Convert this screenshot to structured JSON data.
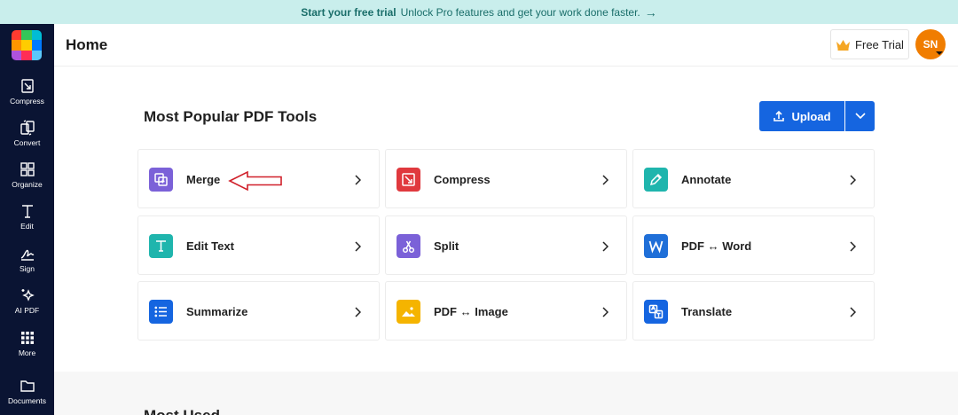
{
  "banner": {
    "bold_text": "Start your free trial",
    "text": "Unlock Pro features and get your work done faster.",
    "arrow": "→"
  },
  "sidebar": {
    "items": [
      {
        "label": "Compress",
        "icon": "compress-icon"
      },
      {
        "label": "Convert",
        "icon": "convert-icon"
      },
      {
        "label": "Organize",
        "icon": "organize-icon"
      },
      {
        "label": "Edit",
        "icon": "edit-text-icon"
      },
      {
        "label": "Sign",
        "icon": "sign-icon"
      },
      {
        "label": "AI PDF",
        "icon": "ai-sparkle-icon"
      },
      {
        "label": "More",
        "icon": "grid-dots-icon"
      },
      {
        "label": "Documents",
        "icon": "folder-icon"
      }
    ]
  },
  "header": {
    "title": "Home",
    "free_trial_label": "Free Trial",
    "avatar_initials": "SN"
  },
  "main": {
    "section_title": "Most Popular PDF Tools",
    "upload_label": "Upload",
    "recent_title": "Most Used"
  },
  "tools": [
    {
      "label": "Merge",
      "icon": "merge-icon",
      "color": "#7b61d8"
    },
    {
      "label": "Compress",
      "icon": "compress-icon",
      "color": "#e0393e"
    },
    {
      "label": "Annotate",
      "icon": "pen-icon",
      "color": "#1fb5ad"
    },
    {
      "label": "Edit Text",
      "icon": "text-icon",
      "color": "#1fb5ad"
    },
    {
      "label": "Split",
      "icon": "scissors-icon",
      "color": "#7b61d8"
    },
    {
      "label": "PDF ↔ Word",
      "icon": "word-icon",
      "color": "#1f6fd8"
    },
    {
      "label": "Summarize",
      "icon": "list-icon",
      "color": "#1565e0"
    },
    {
      "label": "PDF ↔ Image",
      "icon": "image-icon",
      "color": "#f5b400"
    },
    {
      "label": "Translate",
      "icon": "translate-icon",
      "color": "#1565e0"
    }
  ],
  "colors": {
    "accent": "#1565e0",
    "sidebar_bg": "#0a1433",
    "banner_bg": "#c9eeec",
    "avatar_bg": "#f07d00",
    "annotation": "#d0202a"
  }
}
